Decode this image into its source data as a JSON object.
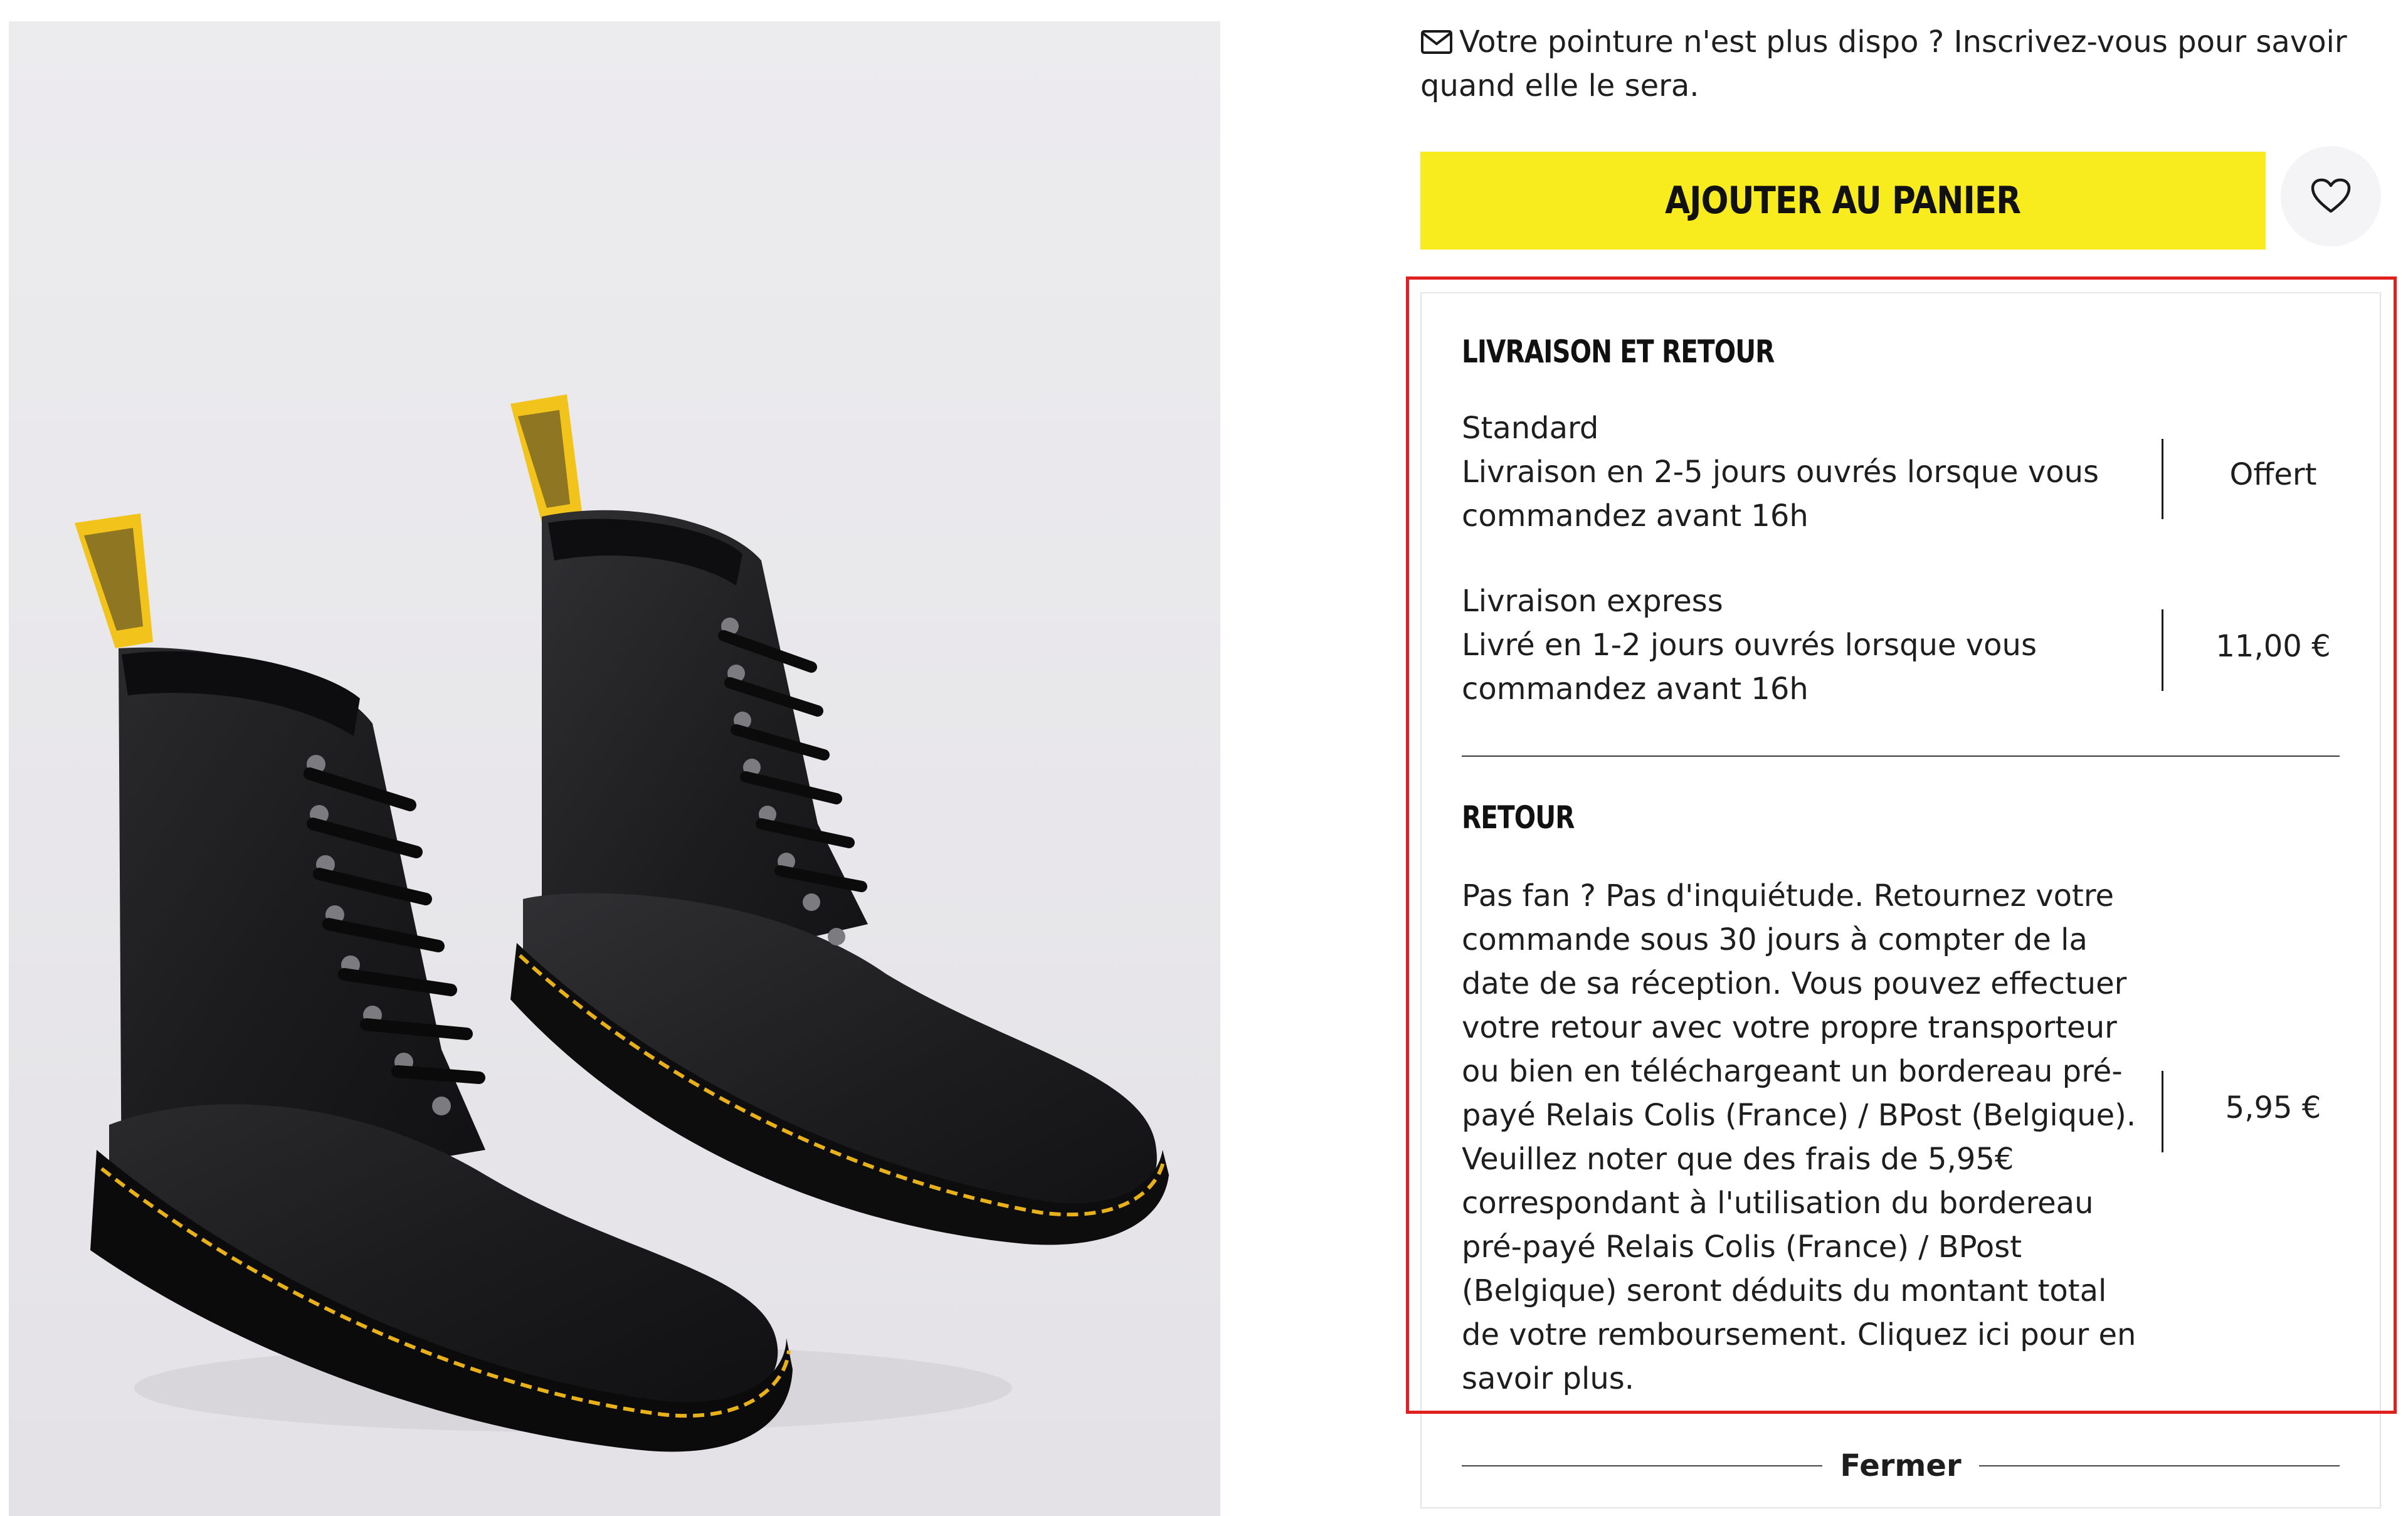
{
  "restock": {
    "icon": "mail-icon",
    "text": "Votre pointure n'est plus dispo ? Inscrivez-vous pour savoir quand elle le sera."
  },
  "cart": {
    "add_label": "AJOUTER AU PANIER",
    "wishlist_icon": "heart-icon"
  },
  "colors": {
    "cta_yellow": "#f9ec1e",
    "highlight_red": "#e01f1f",
    "image_bg": "#eae8ec"
  },
  "shipping": {
    "title": "LIVRAISON ET RETOUR",
    "options": [
      {
        "name": "Standard",
        "description": "Livraison en 2-5 jours ouvrés lorsque vous commandez avant 16h",
        "price": "Offert"
      },
      {
        "name": "Livraison express",
        "description": "Livré en 1-2 jours ouvrés lorsque vous commandez avant 16h",
        "price": "11,00 €"
      }
    ]
  },
  "returns": {
    "title": "RETOUR",
    "text": "Pas fan ? Pas d'inquiétude. Retournez votre commande sous 30 jours à compter de la date de sa réception. Vous pouvez effectuer votre retour avec votre propre transporteur ou bien en téléchargeant un bordereau pré-payé Relais Colis (France) / BPost (Belgique). Veuillez noter que des frais de 5,95€ correspondant à l'utilisation du bordereau pré-payé Relais Colis (France) / BPost (Belgique) seront déduits du montant total de votre remboursement. Cliquez ici pour en savoir plus.",
    "price": "5,95 €"
  },
  "panel": {
    "close_label": "Fermer"
  }
}
